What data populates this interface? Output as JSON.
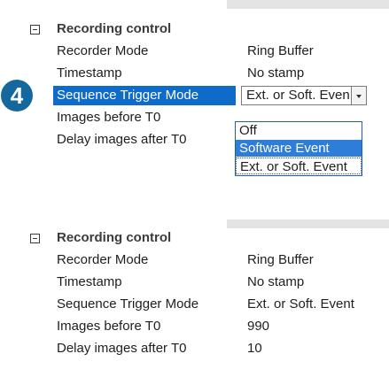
{
  "top_panel": {
    "category": "Recording control",
    "rows": [
      {
        "name": "Recorder Mode",
        "value": "Ring Buffer"
      },
      {
        "name": "Timestamp",
        "value": "No stamp"
      },
      {
        "name": "Sequence Trigger Mode",
        "value": "Ext. or Soft. Even"
      },
      {
        "name": "Images before T0",
        "value": ""
      },
      {
        "name": "Delay images after T0",
        "value": ""
      }
    ],
    "dropdown_options": [
      "Off",
      "Software Event",
      "Ext. or Soft. Event"
    ],
    "dropdown_highlighted": "Software Event"
  },
  "step_badge": "4",
  "bottom_panel": {
    "category": "Recording control",
    "rows": [
      {
        "name": "Recorder Mode",
        "value": "Ring Buffer"
      },
      {
        "name": "Timestamp",
        "value": "No stamp"
      },
      {
        "name": "Sequence Trigger Mode",
        "value": "Ext. or Soft. Event"
      },
      {
        "name": "Images before T0",
        "value": "990"
      },
      {
        "name": "Delay images after T0",
        "value": "10"
      }
    ]
  },
  "colors": {
    "selection": "#0f6bc9",
    "badge": "#14689e",
    "dropdown_highlight": "#2e7dd8"
  }
}
